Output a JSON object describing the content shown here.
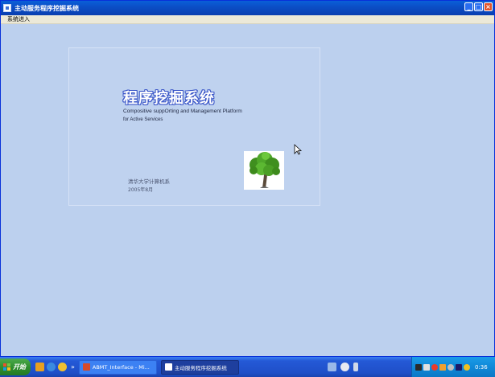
{
  "window": {
    "title": "主动服务程序挖掘系统",
    "buttons": {
      "minimize": "_",
      "maximize": "□",
      "close": "×"
    }
  },
  "menubar": {
    "items": [
      {
        "label": "系统进入"
      }
    ]
  },
  "splash": {
    "title": "程序挖掘系统",
    "subtitle_line1": "Compositive suppOrting and Management Platform",
    "subtitle_line2": "for Active Services",
    "organization": "清华大学计算机系",
    "date": "2005年8月",
    "image_icon": "tree-image"
  },
  "taskbar": {
    "start_label": "开始",
    "quick_launch_more": "»",
    "tasks": [
      {
        "label": "ABMT_Interface - Mi...",
        "active": false
      },
      {
        "label": "主动服务程序挖掘系统",
        "active": true
      }
    ],
    "clock": "0:36"
  },
  "colors": {
    "desktop": "#bcd0ee",
    "titlebar": "#0b4fc7",
    "taskbar": "#2459d6",
    "start": "#2f8f2f",
    "tray": "#1089d8",
    "title_outline": "#3a56c8"
  }
}
